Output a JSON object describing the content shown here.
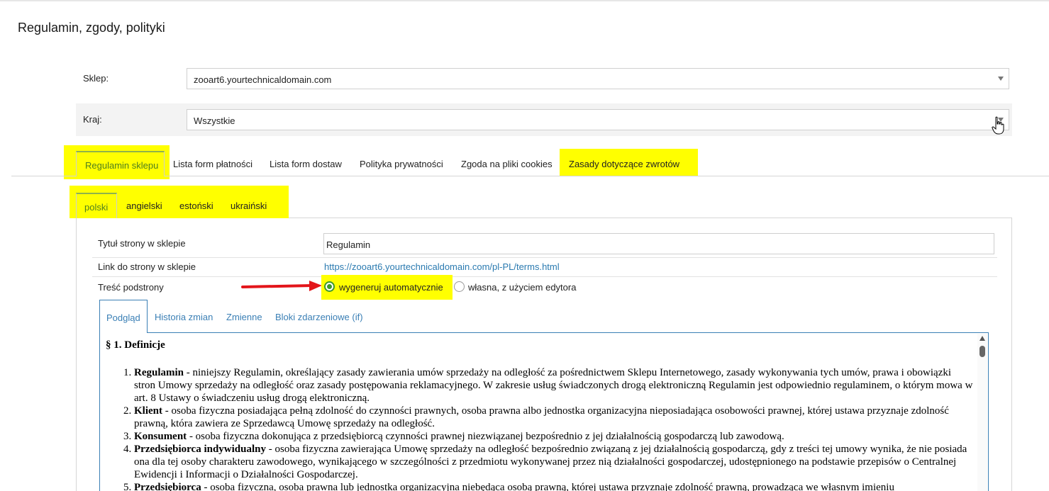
{
  "page": {
    "title": "Regulamin, zgody, polityki"
  },
  "filters": {
    "shop_label": "Sklep:",
    "shop_value": "zooart6.yourtechnicaldomain.com",
    "country_label": "Kraj:",
    "country_value": "Wszystkie"
  },
  "main_tabs": [
    {
      "label": "Regulamin sklepu",
      "active": true,
      "highlighted": true
    },
    {
      "label": "Lista form płatności",
      "active": false
    },
    {
      "label": "Lista form dostaw",
      "active": false
    },
    {
      "label": "Polityka prywatności",
      "active": false
    },
    {
      "label": "Zgoda na pliki cookies",
      "active": false
    },
    {
      "label": "Zasady dotyczące zwrotów",
      "active": false,
      "highlighted": true
    }
  ],
  "lang_tabs": [
    {
      "label": "polski",
      "active": true
    },
    {
      "label": "angielski",
      "active": false
    },
    {
      "label": "estoński",
      "active": false
    },
    {
      "label": "ukraiński",
      "active": false
    }
  ],
  "props": {
    "title_label": "Tytuł strony w sklepie",
    "title_value": "Regulamin",
    "link_label": "Link do strony w sklepie",
    "link_value": "https://zooart6.yourtechnicaldomain.com/pl-PL/terms.html",
    "content_label": "Treść podstrony",
    "option_auto": "wygeneruj automatycznie",
    "option_custom": "własna, z użyciem edytora",
    "selected_option": "wygeneruj automatycznie"
  },
  "sub_tabs": [
    {
      "label": "Podgląd",
      "active": true
    },
    {
      "label": "Historia zmian",
      "active": false
    },
    {
      "label": "Zmienne",
      "active": false
    },
    {
      "label": "Bloki zdarzeniowe (if)",
      "active": false
    }
  ],
  "document": {
    "heading": "§ 1. Definicje",
    "items": [
      {
        "term": "Regulamin",
        "text": " - niniejszy Regulamin, określający zasady zawierania umów sprzedaży na odległość za pośrednictwem Sklepu Internetowego, zasady wykonywania tych umów, prawa i obowiązki stron Umowy sprzedaży na odległość oraz zasady postępowania reklamacyjnego. W zakresie usług świadczonych drogą elektroniczną Regulamin jest odpowiednio regulaminem, o którym mowa w art. 8 Ustawy o świadczeniu usług drogą elektroniczną."
      },
      {
        "term": "Klient",
        "text": " - osoba fizyczna posiadająca pełną zdolność do czynności prawnych, osoba prawna albo jednostka organizacyjna nieposiadająca osobowości prawnej, której ustawa przyznaje zdolność prawną, która zawiera ze Sprzedawcą Umowę sprzedaży na odległość."
      },
      {
        "term": "Konsument",
        "text": " - osoba fizyczna dokonująca z przedsiębiorcą czynności prawnej niezwiązanej bezpośrednio z jej działalnością gospodarczą lub zawodową."
      },
      {
        "term": "Przedsiębiorca indywidualny",
        "text": " - osoba fizyczna zawierająca Umowę sprzedaży na odległość bezpośrednio związaną z jej działalnością gospodarczą, gdy z treści tej umowy wynika, że nie posiada ona dla tej osoby charakteru zawodowego, wynikającego w szczególności z przedmiotu wykonywanej przez nią działalności gospodarczej, udostępnionego na podstawie przepisów o Centralnej Ewidencji i Informacji o Działalności Gospodarczej."
      },
      {
        "term": "Przedsiębiorca",
        "text": " - osoba fizyczna, osoba prawna lub jednostka organizacyjna niebędąca osobą prawną, której ustawa przyznaje zdolność prawną, prowadząca we własnym imieniu"
      }
    ]
  },
  "colors": {
    "highlight": "#ffff00",
    "accent_green": "#3d9a2a",
    "link_blue": "#2a7ab0",
    "arrow_red": "#e3151a"
  }
}
